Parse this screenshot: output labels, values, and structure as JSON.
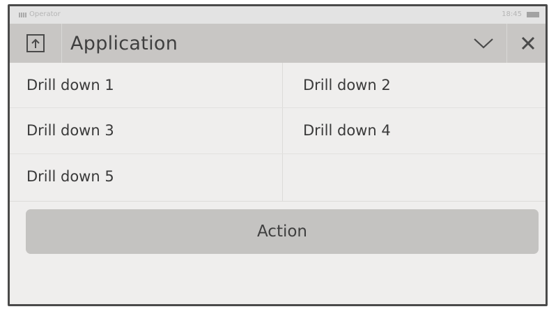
{
  "status_bar": {
    "operator": "Operator",
    "time": "18:45"
  },
  "header": {
    "title": "Application",
    "app_icon": "upload-box-icon",
    "collapse_icon": "chevron-down-icon",
    "close_icon": "close-icon"
  },
  "grid": {
    "items": [
      {
        "label": "Drill down 1"
      },
      {
        "label": "Drill down 2"
      },
      {
        "label": "Drill down 3"
      },
      {
        "label": "Drill down 4"
      },
      {
        "label": "Drill down 5"
      }
    ]
  },
  "action": {
    "label": "Action"
  },
  "colors": {
    "title_bar": "#c8c6c4",
    "background": "#efeeed",
    "button": "#c4c3c1",
    "text": "#3a3a3a"
  }
}
